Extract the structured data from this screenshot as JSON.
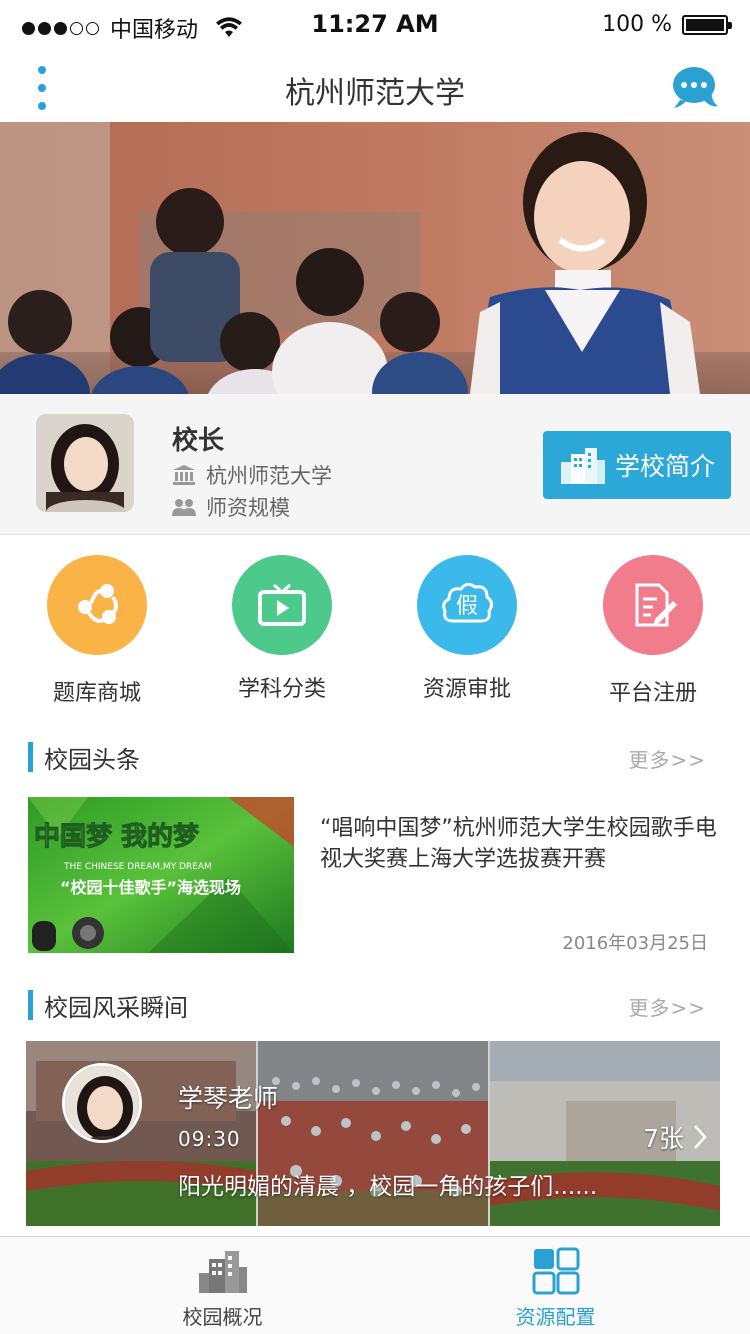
{
  "status_bar": {
    "carrier": "中国移动",
    "time": "11:27 AM",
    "battery": "100 %"
  },
  "nav": {
    "title": "杭州师范大学"
  },
  "profile": {
    "role": "校长",
    "school": "杭州师范大学",
    "staff_label": "师资规模",
    "intro_button": "学校简介"
  },
  "features": [
    {
      "label": "题库商城",
      "color": "#f9b347",
      "icon": "share-icon"
    },
    {
      "label": "学科分类",
      "color": "#4ec98c",
      "icon": "tv-play-icon"
    },
    {
      "label": "资源审批",
      "color": "#3bb9ea",
      "icon": "fake-cloud-icon"
    },
    {
      "label": "平台注册",
      "color": "#f07c8c",
      "icon": "edit-doc-icon"
    }
  ],
  "news_section": {
    "title": "校园头条",
    "more": "更多>>",
    "item": {
      "title": "“唱响中国梦”杭州师范大学生校园歌手电视大奖赛上海大学选拔赛开赛",
      "date": "2016年03月25日",
      "thumb_text_1": "中国梦 我的梦",
      "thumb_text_2": "THE CHINESE DREAM,MY DREAM",
      "thumb_text_3": "“校园十佳歌手”海选现场"
    }
  },
  "gallery_section": {
    "title": "校园风采瞬间",
    "more": "更多>>",
    "item": {
      "name": "学琴老师",
      "time": "09:30",
      "caption": "阳光明媚的清晨 ，校园一角的孩子们......",
      "count": "7张"
    }
  },
  "tabbar": [
    {
      "label": "校园概况",
      "icon": "building-icon",
      "active": false
    },
    {
      "label": "资源配置",
      "icon": "grid-icon",
      "active": true
    }
  ],
  "colors": {
    "accent": "#2aa1d3",
    "button": "#2ba8d8"
  }
}
